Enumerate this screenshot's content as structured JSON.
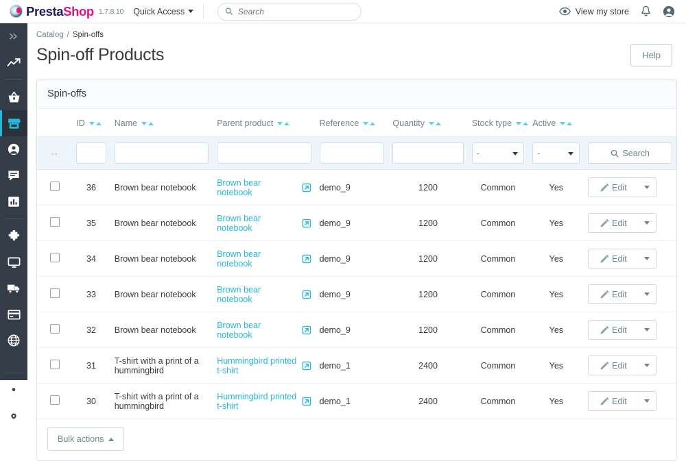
{
  "header": {
    "brand_first": "Presta",
    "brand_second": "Shop",
    "version": "1.7.8.10",
    "quick_access_label": "Quick Access",
    "search_placeholder": "Search",
    "search_value": "",
    "view_store_label": "View my store",
    "icons": {
      "search": "search-icon",
      "eye": "eye-icon",
      "bell": "bell-icon",
      "account": "account-icon",
      "caret": "chevron-down-icon"
    }
  },
  "sidebar": {
    "items": [
      {
        "name": "expand-menu",
        "icon": "chevron-double-right-icon",
        "active": false
      },
      {
        "name": "dashboard",
        "icon": "trending-up-icon",
        "active": false
      },
      {
        "name": "orders",
        "icon": "shopping-basket-icon",
        "active": false
      },
      {
        "name": "catalog",
        "icon": "store-icon",
        "active": true
      },
      {
        "name": "customers",
        "icon": "person-circle-icon",
        "active": false
      },
      {
        "name": "customer-service",
        "icon": "chat-bubble-icon",
        "active": false
      },
      {
        "name": "stats",
        "icon": "bar-chart-icon",
        "active": false
      },
      {
        "name": "modules",
        "icon": "puzzle-piece-icon",
        "active": false
      },
      {
        "name": "design",
        "icon": "monitor-icon",
        "active": false
      },
      {
        "name": "shipping",
        "icon": "truck-icon",
        "active": false
      },
      {
        "name": "payment",
        "icon": "credit-card-icon",
        "active": false
      },
      {
        "name": "international",
        "icon": "globe-icon",
        "active": false
      },
      {
        "name": "shop-parameters",
        "icon": "gear-icon",
        "active": false
      },
      {
        "name": "advanced-parameters",
        "icon": "gear-cog-icon",
        "active": false
      }
    ]
  },
  "breadcrumb": {
    "parent": "Catalog",
    "separator": "/",
    "current": "Spin-offs"
  },
  "page": {
    "title": "Spin-off Products",
    "help_label": "Help"
  },
  "panel": {
    "title": "Spin-offs"
  },
  "table": {
    "columns": [
      {
        "key": "checkbox",
        "label": "",
        "sortable": false
      },
      {
        "key": "id",
        "label": "ID",
        "sortable": true
      },
      {
        "key": "name",
        "label": "Name",
        "sortable": true
      },
      {
        "key": "parent_product",
        "label": "Parent product",
        "sortable": true
      },
      {
        "key": "reference",
        "label": "Reference",
        "sortable": true
      },
      {
        "key": "quantity",
        "label": "Quantity",
        "sortable": true
      },
      {
        "key": "stock_type",
        "label": "Stock type",
        "sortable": true
      },
      {
        "key": "active",
        "label": "Active",
        "sortable": true
      },
      {
        "key": "actions",
        "label": "",
        "sortable": false
      }
    ],
    "filters": {
      "checkbox_placeholder_dash": "--",
      "id": "",
      "name": "",
      "parent_product": "",
      "reference": "",
      "quantity": "",
      "stock_type_selected": "-",
      "stock_type_options": [
        "-"
      ],
      "active_selected": "-",
      "active_options": [
        "-"
      ],
      "search_label": "Search"
    },
    "rows": [
      {
        "id": "36",
        "name": "Brown bear notebook",
        "parent_product": "Brown bear notebook",
        "reference": "demo_9",
        "quantity": "1200",
        "stock_type": "Common",
        "active": "Yes",
        "edit_label": "Edit"
      },
      {
        "id": "35",
        "name": "Brown bear notebook",
        "parent_product": "Brown bear notebook",
        "reference": "demo_9",
        "quantity": "1200",
        "stock_type": "Common",
        "active": "Yes",
        "edit_label": "Edit"
      },
      {
        "id": "34",
        "name": "Brown bear notebook",
        "parent_product": "Brown bear notebook",
        "reference": "demo_9",
        "quantity": "1200",
        "stock_type": "Common",
        "active": "Yes",
        "edit_label": "Edit"
      },
      {
        "id": "33",
        "name": "Brown bear notebook",
        "parent_product": "Brown bear notebook",
        "reference": "demo_9",
        "quantity": "1200",
        "stock_type": "Common",
        "active": "Yes",
        "edit_label": "Edit"
      },
      {
        "id": "32",
        "name": "Brown bear notebook",
        "parent_product": "Brown bear notebook",
        "reference": "demo_9",
        "quantity": "1200",
        "stock_type": "Common",
        "active": "Yes",
        "edit_label": "Edit"
      },
      {
        "id": "31",
        "name": "T-shirt with a print of a hummingbird",
        "parent_product": "Hummingbird printed t-shirt",
        "reference": "demo_1",
        "quantity": "2400",
        "stock_type": "Common",
        "active": "Yes",
        "edit_label": "Edit"
      },
      {
        "id": "30",
        "name": "T-shirt with a print of a hummingbird",
        "parent_product": "Hummingbird printed t-shirt",
        "reference": "demo_1",
        "quantity": "2400",
        "stock_type": "Common",
        "active": "Yes",
        "edit_label": "Edit"
      }
    ]
  },
  "footer": {
    "bulk_actions_label": "Bulk actions"
  },
  "colors": {
    "accent_cyan": "#25b9d7",
    "brand_pink": "#e5127d",
    "brand_navy": "#251b5b",
    "sidebar_bg": "#343c48",
    "text": "#363a41",
    "muted": "#6c868e"
  }
}
